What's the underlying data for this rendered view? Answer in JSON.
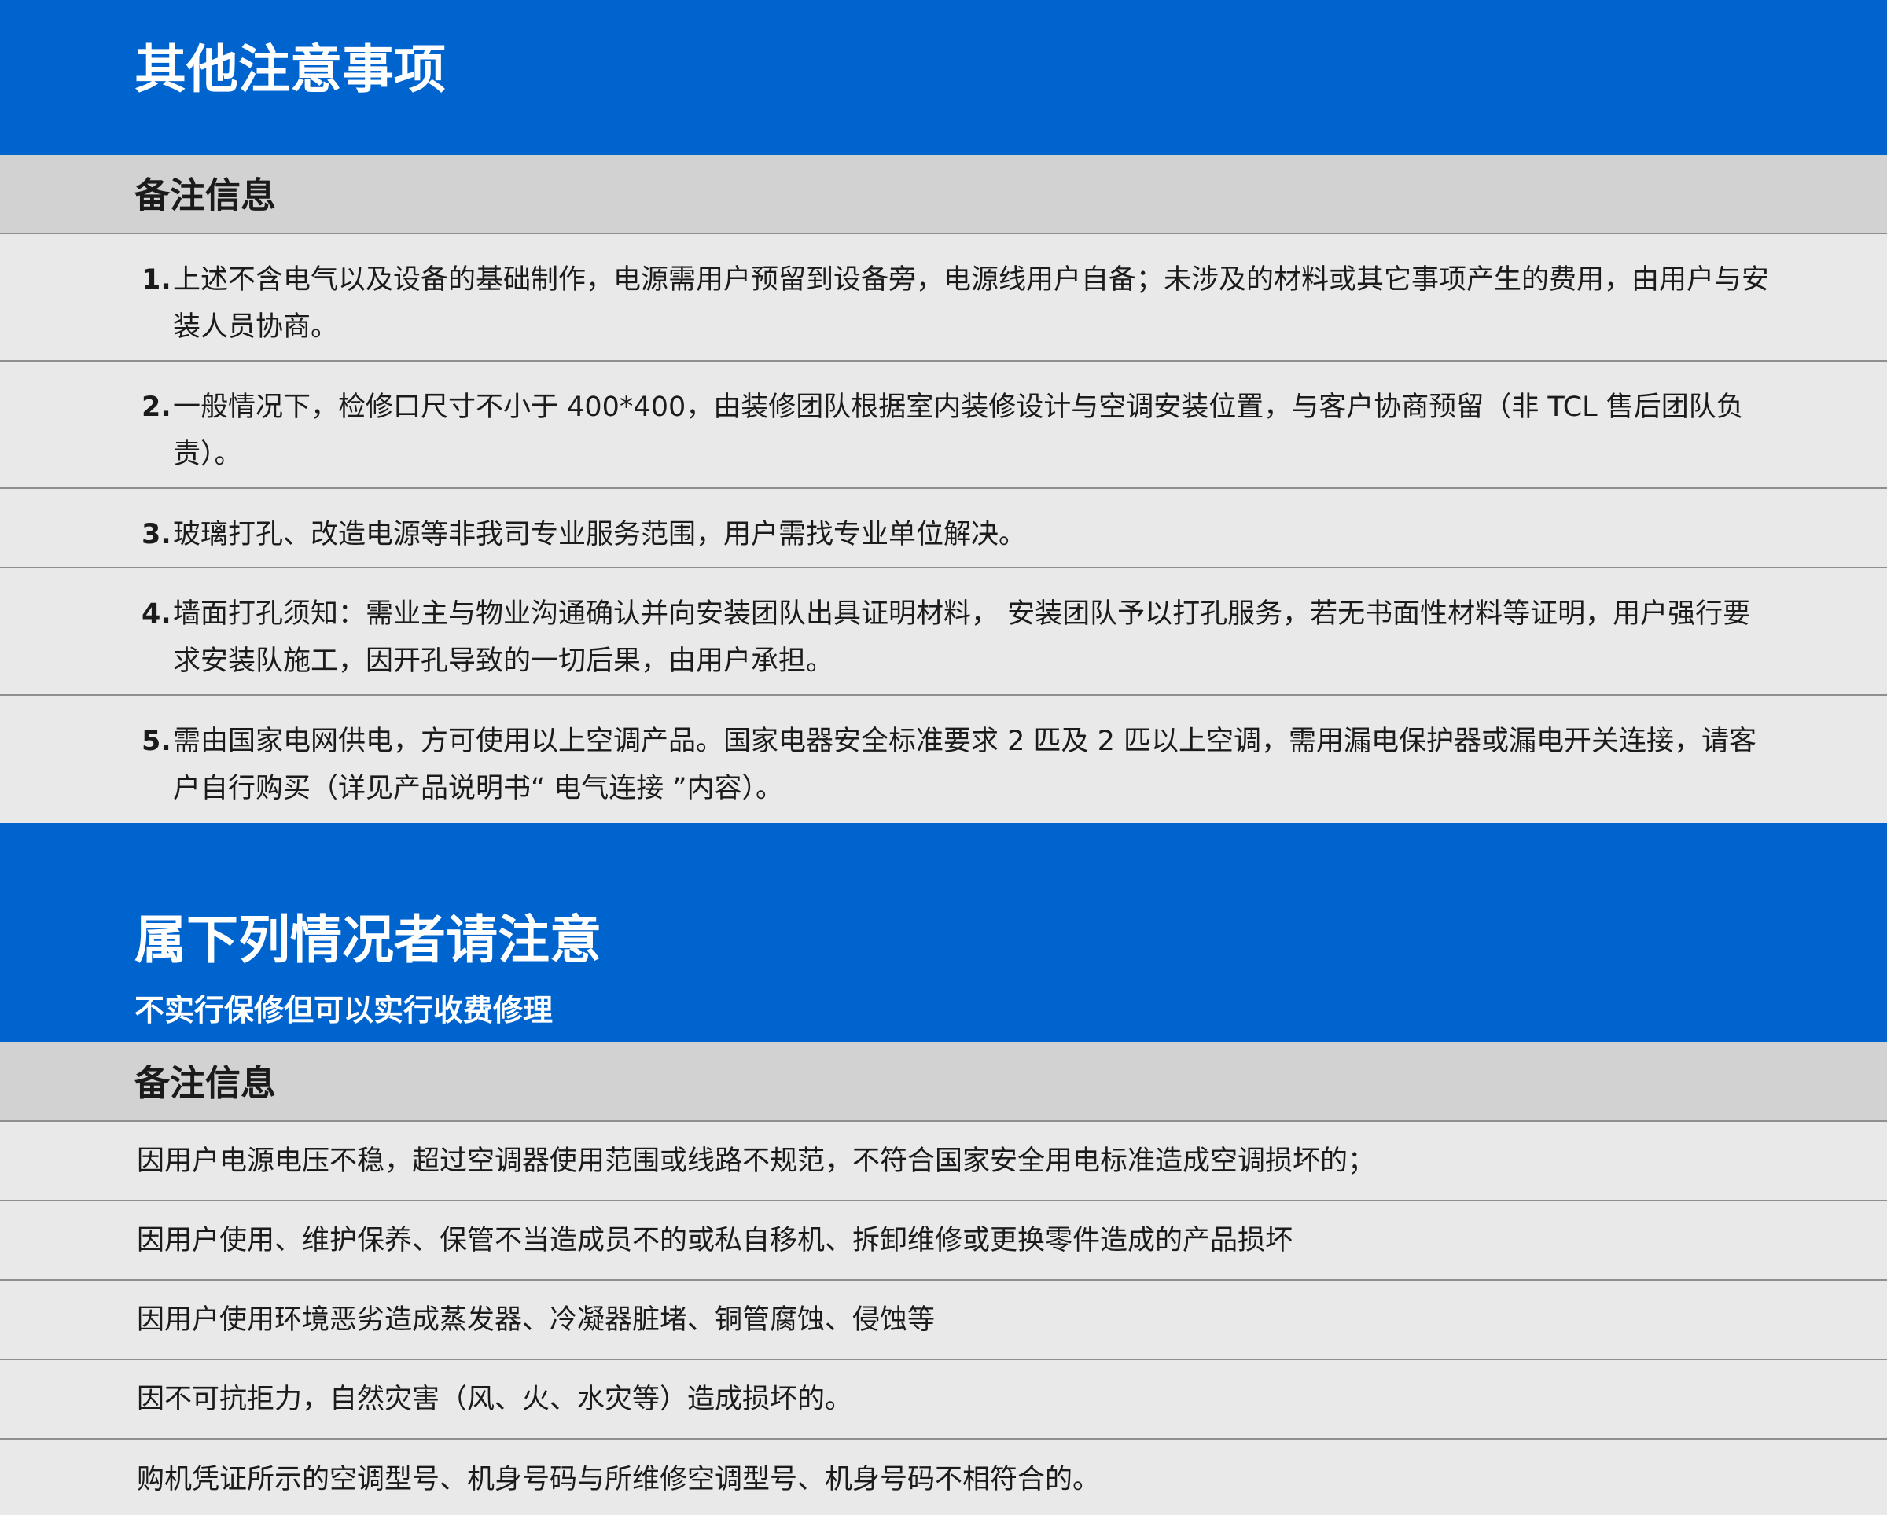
{
  "section1": {
    "title": "其他注意事项",
    "header": "备注信息",
    "items": [
      {
        "number": "1.",
        "text": "上述不含电气以及设备的基础制作，电源需用户预留到设备旁，电源线用户自备；未涉及的材料或其它事项产生的费用，由用户与安装人员协商。"
      },
      {
        "number": "2.",
        "text": "一般情况下，检修口尺寸不小于 400*400，由装修团队根据室内装修设计与空调安装位置，与客户协商预留（非 TCL 售后团队负责）。"
      },
      {
        "number": "3.",
        "text": "玻璃打孔、改造电源等非我司专业服务范围，用户需找专业单位解决。"
      },
      {
        "number": "4.",
        "text": "墙面打孔须知：需业主与物业沟通确认并向安装团队出具证明材料， 安装团队予以打孔服务，若无书面性材料等证明，用户强行要求安装队施工，因开孔导致的一切后果，由用户承担。"
      },
      {
        "number": "5.",
        "text": "需由国家电网供电，方可使用以上空调产品。国家电器安全标准要求 2 匹及 2 匹以上空调，需用漏电保护器或漏电开关连接，请客户自行购买（详见产品说明书“ 电气连接 ”内容）。"
      }
    ]
  },
  "section2": {
    "title": "属下列情况者请注意",
    "subtitle": "不实行保修但可以实行收费修理",
    "header": "备注信息",
    "items": [
      {
        "text": "因用户电源电压不稳，超过空调器使用范围或线路不规范，不符合国家安全用电标准造成空调损坏的；"
      },
      {
        "text": "因用户使用、维护保养、保管不当造成员不的或私自移机、拆卸维修或更换零件造成的产品损坏"
      },
      {
        "text": "因用户使用环境恶劣造成蒸发器、冷凝器脏堵、铜管腐蚀、侵蚀等"
      },
      {
        "text": "因不可抗拒力，自然灾害（风、火、水灾等）造成损坏的。"
      },
      {
        "text": "购机凭证所示的空调型号、机身号码与所维修空调型号、机身号码不相符合的。"
      }
    ]
  },
  "colors": {
    "brand_blue": "#0064cf",
    "header_gray": "#d2d2d2",
    "row_gray": "#e9e9e9",
    "divider": "#8f8f8f"
  }
}
